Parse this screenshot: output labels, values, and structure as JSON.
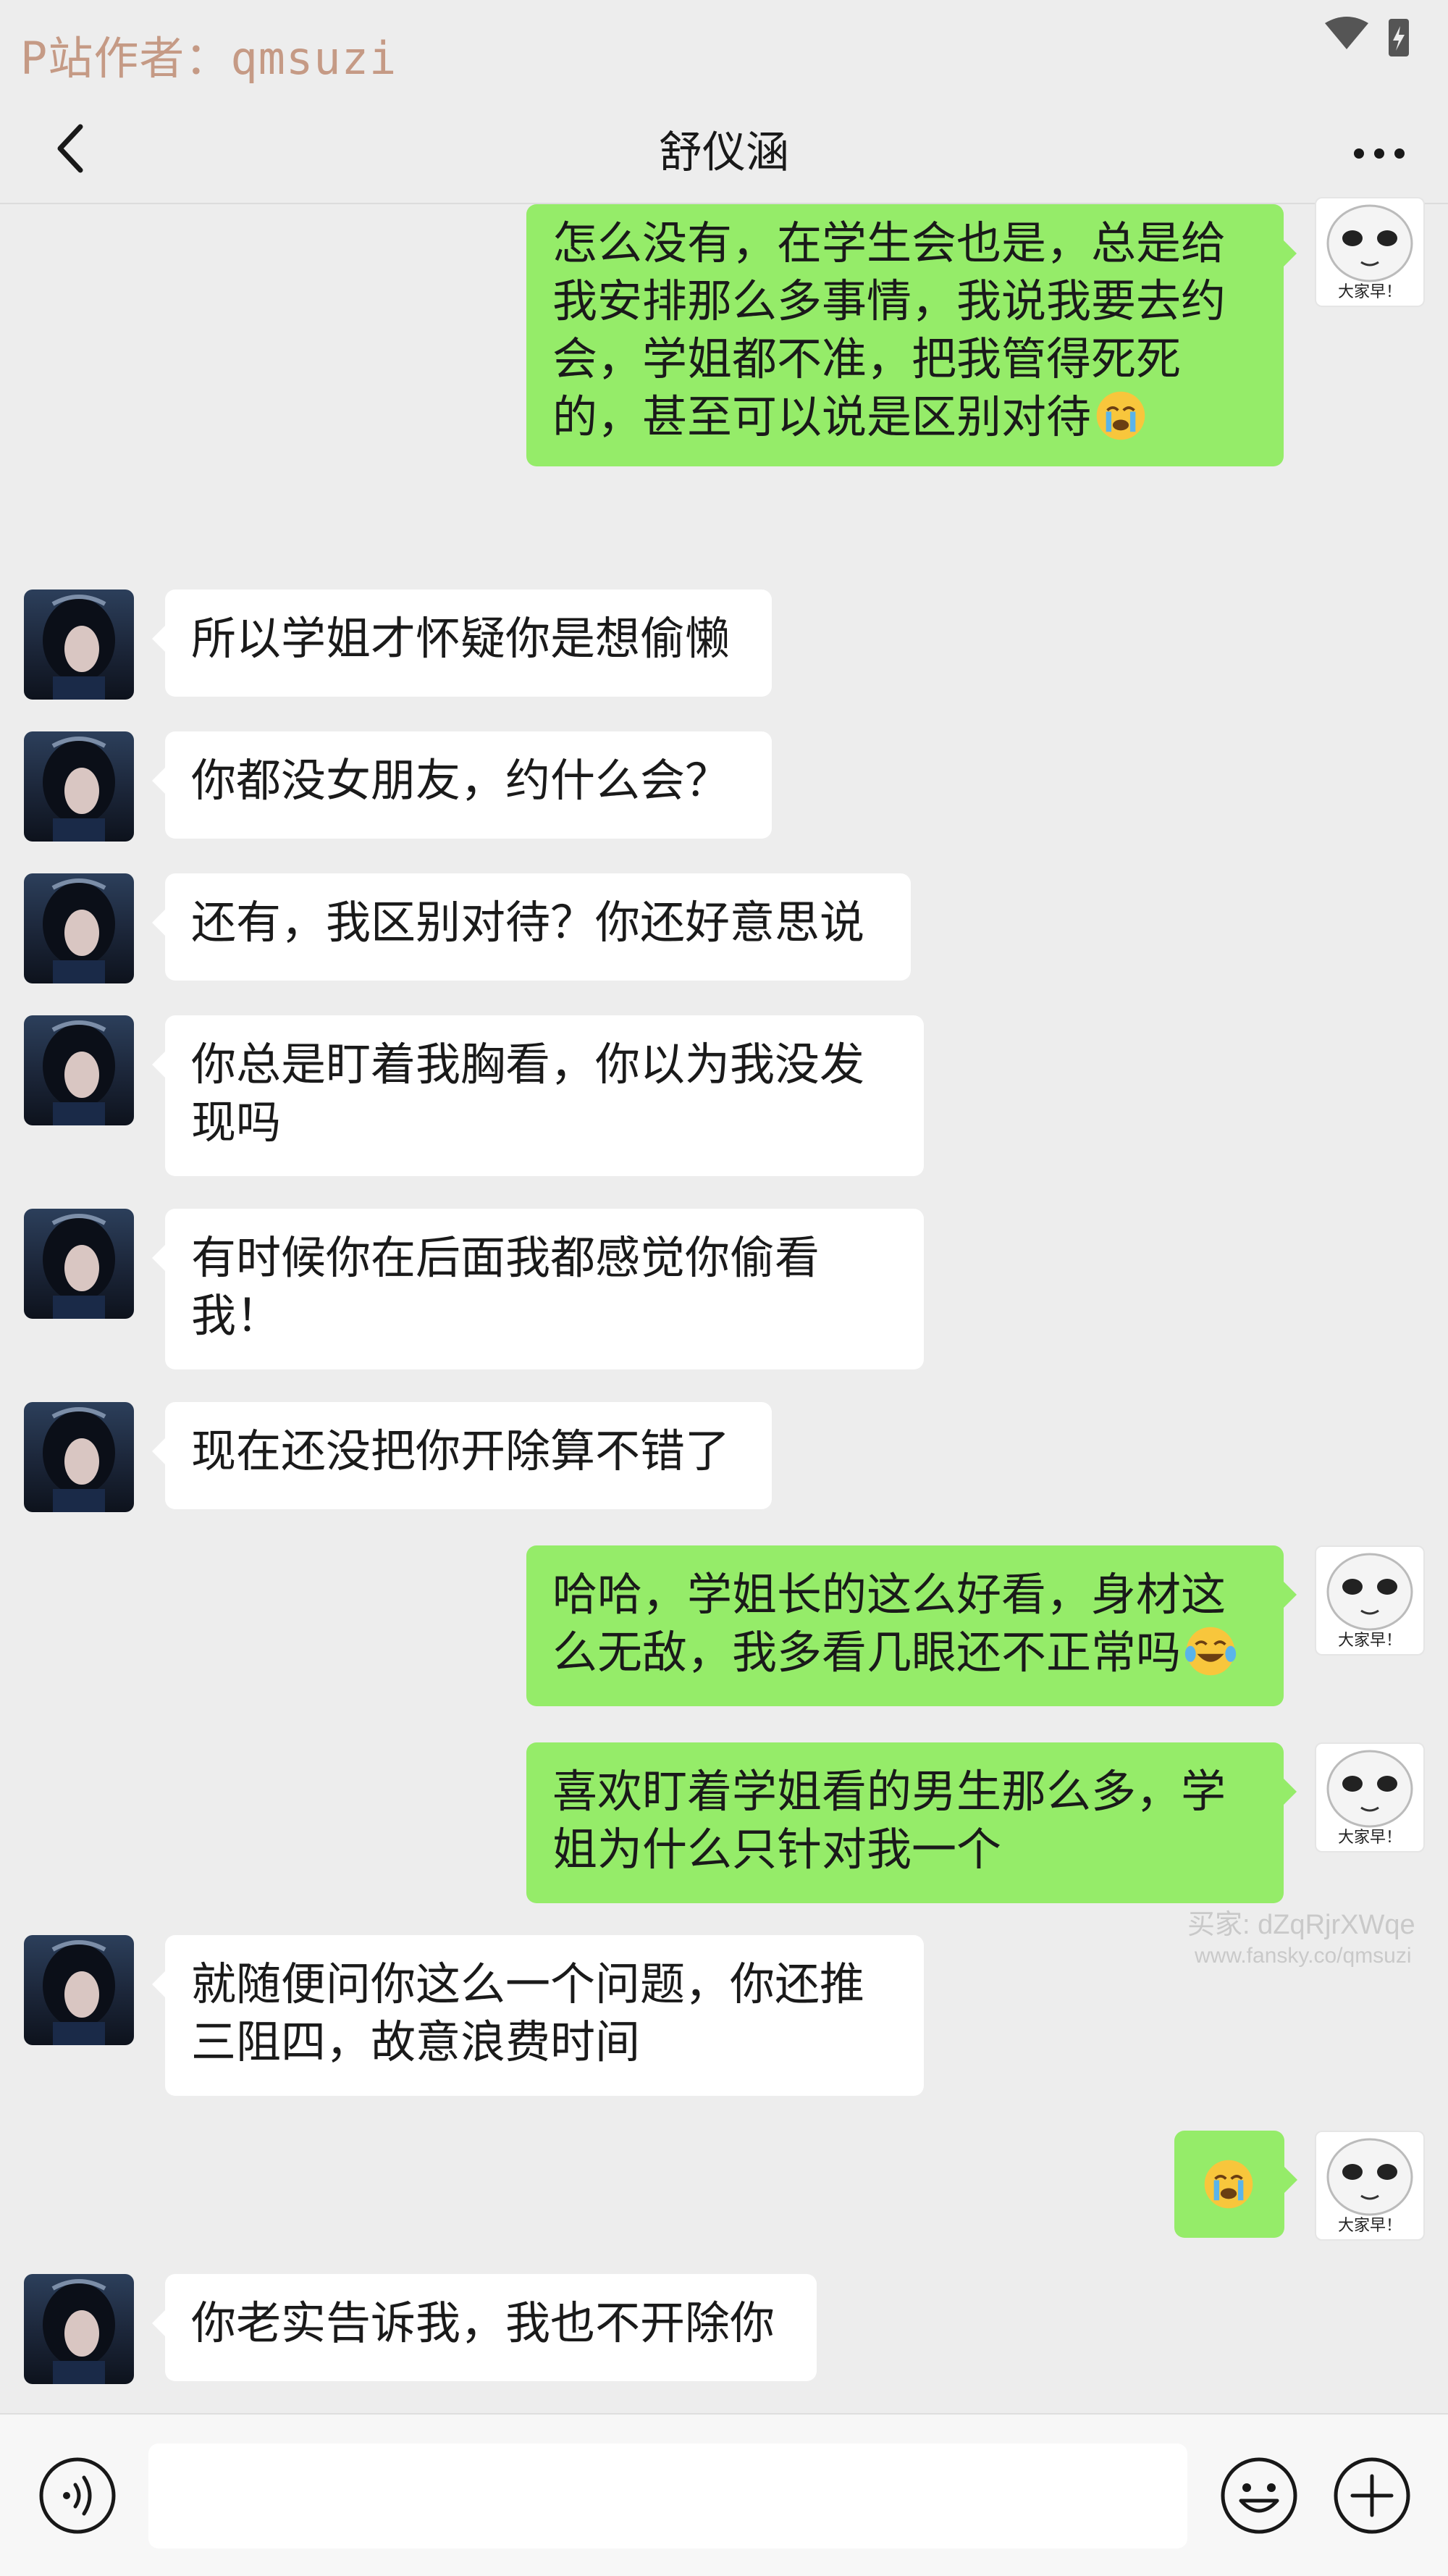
{
  "statusbar": {
    "watermark": "P站作者：qmsuzi"
  },
  "header": {
    "title": "舒仪涵"
  },
  "messages": [
    {
      "side": "out",
      "text": "怎么没有，在学生会也是，总是给我安排那么多事情，我说我要去约会，学姐都不准，把我管得死死的，甚至可以说是区别对待",
      "emoji": "crying-face"
    },
    {
      "side": "in",
      "text": "所以学姐才怀疑你是想偷懒"
    },
    {
      "side": "in",
      "text": "你都没女朋友，约什么会？"
    },
    {
      "side": "in",
      "text": "还有，我区别对待？你还好意思说"
    },
    {
      "side": "in",
      "text": "你总是盯着我胸看，你以为我没发现吗"
    },
    {
      "side": "in",
      "text": "有时候你在后面我都感觉你偷看我！"
    },
    {
      "side": "in",
      "text": "现在还没把你开除算不错了"
    },
    {
      "side": "out",
      "text": "哈哈，学姐长的这么好看，身材这么无敌，我多看几眼还不正常吗",
      "emoji": "tears-of-joy"
    },
    {
      "side": "out",
      "text": "喜欢盯着学姐看的男生那么多，学姐为什么只针对我一个"
    },
    {
      "side": "in",
      "text": "就随便问你这么一个问题，你还推三阻四，故意浪费时间"
    },
    {
      "side": "out",
      "text": "",
      "emoji": "crying-face"
    },
    {
      "side": "in",
      "text": "你老实告诉我，我也不开除你"
    }
  ],
  "sticker_avatar_caption": "大家早！",
  "watermark_mid": {
    "line1": "买家: dZqRjrXWqe",
    "line2": "www.fansky.co/qmsuzi"
  },
  "input": {
    "value": ""
  },
  "icons": {
    "back": "chevron-left-icon",
    "more": "more-dots-icon",
    "voice": "voice-icon",
    "emoji": "emoji-icon",
    "plus": "plus-icon"
  },
  "colors": {
    "outgoing_bubble": "#95ec69",
    "incoming_bubble": "#ffffff",
    "background": "#ededed"
  }
}
